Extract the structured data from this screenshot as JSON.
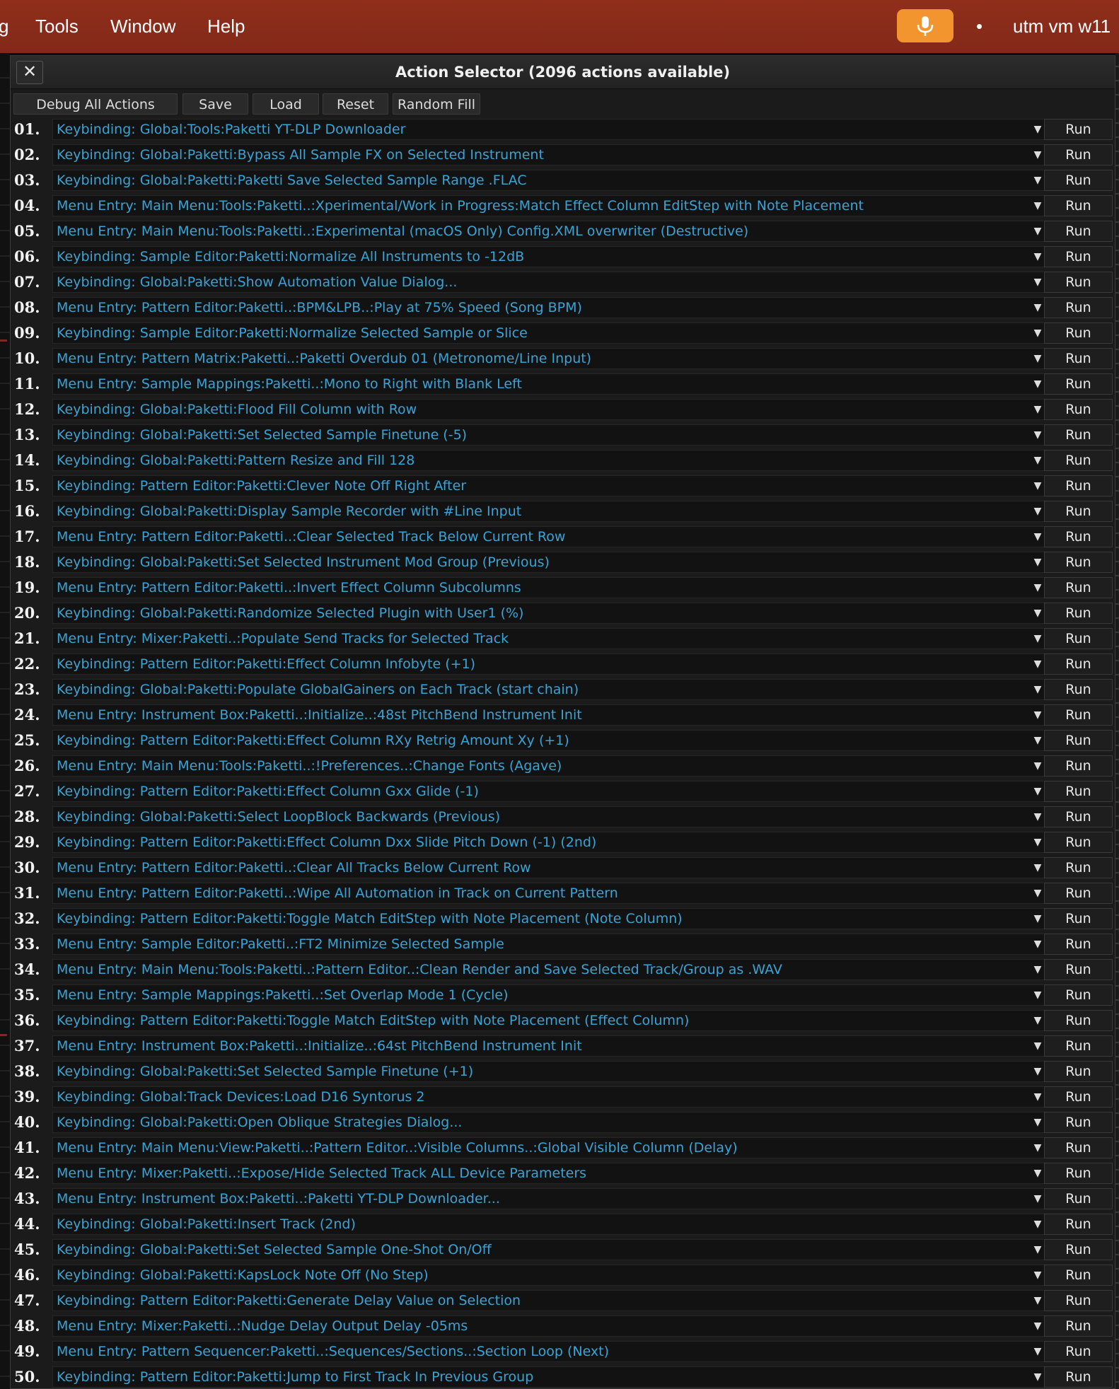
{
  "menubar": {
    "partial_item": "g",
    "items": [
      "Tools",
      "Window",
      "Help"
    ],
    "status_dot": "•",
    "host_name": "utm vm w11",
    "mic_icon": "microphone-icon",
    "accent": "#f2952e",
    "bar_color": "#8a2b1a"
  },
  "dialog": {
    "close_label": "✕",
    "title": "Action Selector (2096 actions available)",
    "toolbar": {
      "debug_label": "Debug All Actions",
      "save_label": "Save",
      "load_label": "Load",
      "reset_label": "Reset",
      "random_fill_label": "Random Fill"
    },
    "run_label": "Run",
    "dropdown_icon": "chevron-down-icon",
    "text_color": "#3aa3d6"
  },
  "rows": [
    {
      "num": "01.",
      "action": "Keybinding: Global:Tools:Paketti YT-DLP Downloader"
    },
    {
      "num": "02.",
      "action": "Keybinding: Global:Paketti:Bypass All Sample FX on Selected Instrument"
    },
    {
      "num": "03.",
      "action": "Keybinding: Global:Paketti:Paketti Save Selected Sample Range .FLAC"
    },
    {
      "num": "04.",
      "action": "Menu Entry: Main Menu:Tools:Paketti..:Xperimental/Work in Progress:Match Effect Column EditStep with Note Placement"
    },
    {
      "num": "05.",
      "action": "Menu Entry: Main Menu:Tools:Paketti..:Experimental (macOS Only) Config.XML overwriter (Destructive)"
    },
    {
      "num": "06.",
      "action": "Keybinding: Sample Editor:Paketti:Normalize All Instruments to -12dB"
    },
    {
      "num": "07.",
      "action": "Keybinding: Global:Paketti:Show Automation Value Dialog..."
    },
    {
      "num": "08.",
      "action": "Menu Entry: Pattern Editor:Paketti..:BPM&LPB..:Play at 75% Speed (Song BPM)"
    },
    {
      "num": "09.",
      "action": "Keybinding: Sample Editor:Paketti:Normalize Selected Sample or Slice"
    },
    {
      "num": "10.",
      "action": "Menu Entry: Pattern Matrix:Paketti..:Paketti Overdub 01 (Metronome/Line Input)"
    },
    {
      "num": "11.",
      "action": "Menu Entry: Sample Mappings:Paketti..:Mono to Right with Blank Left"
    },
    {
      "num": "12.",
      "action": "Keybinding: Global:Paketti:Flood Fill Column with Row"
    },
    {
      "num": "13.",
      "action": "Keybinding: Global:Paketti:Set Selected Sample Finetune (-5)"
    },
    {
      "num": "14.",
      "action": "Keybinding: Global:Paketti:Pattern Resize and Fill 128"
    },
    {
      "num": "15.",
      "action": "Keybinding: Pattern Editor:Paketti:Clever Note Off Right After"
    },
    {
      "num": "16.",
      "action": "Keybinding: Global:Paketti:Display Sample Recorder with #Line Input"
    },
    {
      "num": "17.",
      "action": "Menu Entry: Pattern Editor:Paketti..:Clear Selected Track Below Current Row"
    },
    {
      "num": "18.",
      "action": "Keybinding: Global:Paketti:Set Selected Instrument Mod Group (Previous)"
    },
    {
      "num": "19.",
      "action": "Menu Entry: Pattern Editor:Paketti..:Invert Effect Column Subcolumns"
    },
    {
      "num": "20.",
      "action": "Keybinding: Global:Paketti:Randomize Selected Plugin with User1 (%)"
    },
    {
      "num": "21.",
      "action": "Menu Entry: Mixer:Paketti..:Populate Send Tracks for Selected Track"
    },
    {
      "num": "22.",
      "action": "Keybinding: Pattern Editor:Paketti:Effect Column Infobyte (+1)"
    },
    {
      "num": "23.",
      "action": "Keybinding: Global:Paketti:Populate GlobalGainers on Each Track (start chain)"
    },
    {
      "num": "24.",
      "action": "Menu Entry: Instrument Box:Paketti..:Initialize..:48st PitchBend Instrument Init"
    },
    {
      "num": "25.",
      "action": "Keybinding: Pattern Editor:Paketti:Effect Column RXy Retrig Amount Xy (+1)"
    },
    {
      "num": "26.",
      "action": "Menu Entry: Main Menu:Tools:Paketti..:!Preferences..:Change Fonts (Agave)"
    },
    {
      "num": "27.",
      "action": "Keybinding: Pattern Editor:Paketti:Effect Column Gxx Glide (-1)"
    },
    {
      "num": "28.",
      "action": "Keybinding: Global:Paketti:Select LoopBlock Backwards (Previous)"
    },
    {
      "num": "29.",
      "action": "Keybinding: Pattern Editor:Paketti:Effect Column Dxx Slide Pitch Down (-1) (2nd)"
    },
    {
      "num": "30.",
      "action": "Menu Entry: Pattern Editor:Paketti..:Clear All Tracks Below Current Row"
    },
    {
      "num": "31.",
      "action": "Menu Entry: Pattern Editor:Paketti..:Wipe All Automation in Track on Current Pattern"
    },
    {
      "num": "32.",
      "action": "Keybinding: Pattern Editor:Paketti:Toggle Match EditStep with Note Placement (Note Column)"
    },
    {
      "num": "33.",
      "action": "Menu Entry: Sample Editor:Paketti..:FT2 Minimize Selected Sample"
    },
    {
      "num": "34.",
      "action": "Menu Entry: Main Menu:Tools:Paketti..:Pattern Editor..:Clean Render and Save Selected Track/Group as .WAV"
    },
    {
      "num": "35.",
      "action": "Menu Entry: Sample Mappings:Paketti..:Set Overlap Mode 1 (Cycle)"
    },
    {
      "num": "36.",
      "action": "Keybinding: Pattern Editor:Paketti:Toggle Match EditStep with Note Placement (Effect Column)"
    },
    {
      "num": "37.",
      "action": "Menu Entry: Instrument Box:Paketti..:Initialize..:64st PitchBend Instrument Init"
    },
    {
      "num": "38.",
      "action": "Keybinding: Global:Paketti:Set Selected Sample Finetune (+1)"
    },
    {
      "num": "39.",
      "action": "Keybinding: Global:Track Devices:Load D16 Syntorus 2"
    },
    {
      "num": "40.",
      "action": "Keybinding: Global:Paketti:Open Oblique Strategies Dialog..."
    },
    {
      "num": "41.",
      "action": "Menu Entry: Main Menu:View:Paketti..:Pattern Editor..:Visible Columns..:Global Visible Column (Delay)"
    },
    {
      "num": "42.",
      "action": "Menu Entry: Mixer:Paketti..:Expose/Hide Selected Track ALL Device Parameters"
    },
    {
      "num": "43.",
      "action": "Menu Entry: Instrument Box:Paketti..:Paketti YT-DLP Downloader..."
    },
    {
      "num": "44.",
      "action": "Keybinding: Global:Paketti:Insert Track (2nd)"
    },
    {
      "num": "45.",
      "action": "Keybinding: Global:Paketti:Set Selected Sample One-Shot On/Off"
    },
    {
      "num": "46.",
      "action": "Keybinding: Global:Paketti:KapsLock Note Off (No Step)"
    },
    {
      "num": "47.",
      "action": "Keybinding: Pattern Editor:Paketti:Generate Delay Value on Selection"
    },
    {
      "num": "48.",
      "action": "Menu Entry: Mixer:Paketti..:Nudge Delay Output Delay -05ms"
    },
    {
      "num": "49.",
      "action": "Menu Entry: Pattern Sequencer:Paketti..:Sequences/Sections..:Section Loop (Next)"
    },
    {
      "num": "50.",
      "action": "Keybinding: Pattern Editor:Paketti:Jump to First Track In Previous Group"
    }
  ]
}
